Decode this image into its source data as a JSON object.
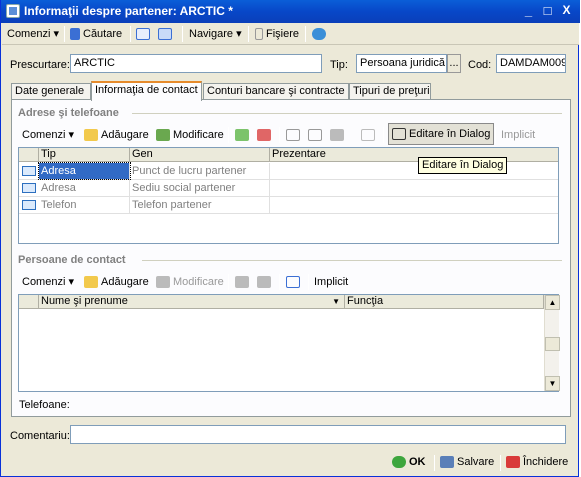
{
  "window": {
    "title": "Informaţii despre partener: ARCTIC *",
    "minimize": "_",
    "maximize": "□",
    "close": "X"
  },
  "toolbar": {
    "comenzi": "Comenzi ▾",
    "cautare": "Căutare",
    "navigare": "Navigare ▾",
    "fisiere": "Fişiere"
  },
  "form": {
    "prescurtare_label": "Prescurtare:",
    "prescurtare_value": "ARCTIC",
    "tip_label": "Tip:",
    "tip_value": "Persoana juridică",
    "tip_btn": "...",
    "cod_label": "Cod:",
    "cod_value": "DAMDAM009"
  },
  "tabs": [
    "Date generale",
    "Informaţia de contact",
    "Conturi bancare şi contracte",
    "Tipuri de preţuri"
  ],
  "adrese": {
    "title": "Adrese şi telefoane",
    "comenzi": "Comenzi ▾",
    "adaugare": "Adăugare",
    "modificare": "Modificare",
    "editare": "Editare în Dialog",
    "implicit": "Implicit",
    "columns": [
      "Tip",
      "Gen",
      "Prezentare"
    ],
    "rows": [
      {
        "tip": "Adresa",
        "gen": "Punct de lucru partener",
        "prez": ""
      },
      {
        "tip": "Adresa",
        "gen": "Sediu social partener",
        "prez": ""
      },
      {
        "tip": "Telefon",
        "gen": "Telefon partener",
        "prez": ""
      }
    ]
  },
  "tooltip": "Editare în Dialog",
  "persoane": {
    "title": "Persoane de contact",
    "comenzi": "Comenzi ▾",
    "adaugare": "Adăugare",
    "modificare": "Modificare",
    "implicit": "Implicit",
    "columns": [
      "Nume şi prenume",
      "Funcţia"
    ],
    "sort_indicator": "▼"
  },
  "telefoane_label": "Telefoane:",
  "comentariu_label": "Comentariu:",
  "buttons": {
    "ok": "OK",
    "salvare": "Salvare",
    "inchidere": "Închidere"
  }
}
